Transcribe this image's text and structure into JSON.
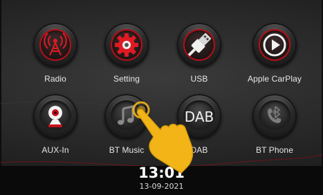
{
  "apps": [
    {
      "label": "Radio",
      "icon": "radio-antenna-icon"
    },
    {
      "label": "Setting",
      "icon": "gear-icon"
    },
    {
      "label": "USB",
      "icon": "usb-plug-icon"
    },
    {
      "label": "Apple CarPlay",
      "icon": "carplay-play-icon"
    },
    {
      "label": "AUX-In",
      "icon": "aux-webcam-icon"
    },
    {
      "label": "BT Music",
      "icon": "music-note-icon"
    },
    {
      "label": "DAB",
      "icon": "dab-text-icon",
      "icon_text": "DAB"
    },
    {
      "label": "BT Phone",
      "icon": "bluetooth-phone-icon"
    }
  ],
  "status": {
    "time": "13:01",
    "date": "13-09-2021"
  },
  "overlay": {
    "icon": "tapping-hand-icon"
  },
  "colors": {
    "accent": "#c4101c",
    "hand": "#f2b417",
    "background": "#2a2a2a"
  }
}
